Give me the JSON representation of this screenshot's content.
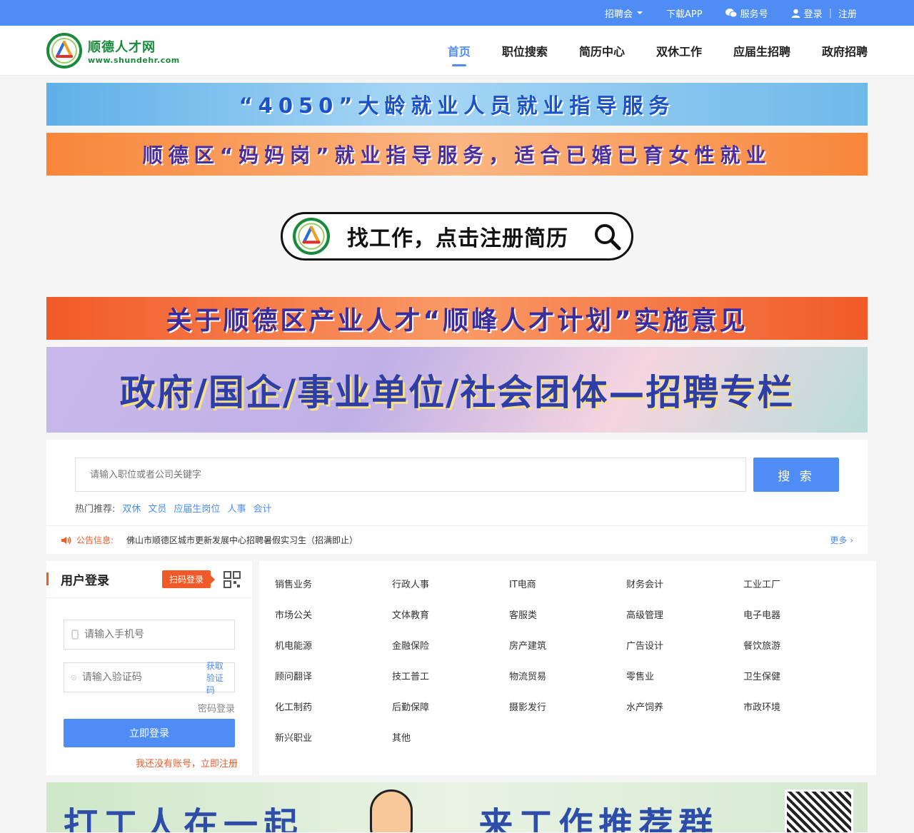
{
  "topbar": {
    "job_fair": "招聘会",
    "download_app": "下载APP",
    "service_account": "服务号",
    "login": "登录",
    "register": "注册"
  },
  "header": {
    "logo_name": "顺德人才网",
    "logo_url": "www.shundehr.com",
    "nav": [
      "首页",
      "职位搜索",
      "简历中心",
      "双休工作",
      "应届生招聘",
      "政府招聘"
    ],
    "active_nav": 0
  },
  "banners": {
    "b1": "“4050”大龄就业人员就业指导服务",
    "b2": "顺德区“妈妈岗”就业指导服务，适合已婚已育女性就业",
    "register_cta": "找工作，点击注册简历",
    "b3": "关于顺德区产业人才“顺峰人才计划”实施意见",
    "b4": "政府/国企/事业单位/社会团体—招聘专栏",
    "b5_left": "打工人在一起",
    "b5_right": "来工作推荐群"
  },
  "search": {
    "placeholder": "请输入职位或者公司关键字",
    "button": "搜 索",
    "hot_label": "热门推荐:",
    "hot_tags": [
      "双休",
      "文员",
      "应届生岗位",
      "人事",
      "会计"
    ]
  },
  "notice": {
    "label": "公告信息:",
    "text": "佛山市顺德区城市更新发展中心招聘暑假实习生（招满即止）",
    "more": "更多 ›"
  },
  "login": {
    "title": "用户登录",
    "scan_tag": "扫码登录",
    "phone_placeholder": "请输入手机号",
    "code_placeholder": "请输入验证码",
    "get_code": "获取验证码",
    "password_login": "密码登录",
    "submit": "立即登录",
    "register_link": "我还没有账号，立即注册"
  },
  "categories": [
    "销售业务",
    "行政人事",
    "IT电商",
    "财务会计",
    "工业工厂",
    "市场公关",
    "文体教育",
    "客服类",
    "高级管理",
    "电子电器",
    "机电能源",
    "金融保险",
    "房产建筑",
    "广告设计",
    "餐饮旅游",
    "顾问翻译",
    "技工普工",
    "物流贸易",
    "零售业",
    "卫生保健",
    "化工制药",
    "后勤保障",
    "摄影发行",
    "水产饲养",
    "市政环境",
    "新兴职业",
    "其他"
  ],
  "colors": {
    "primary": "#4f8df5",
    "accent": "#f05a28",
    "logo_green": "#1a8a3c"
  },
  "icons": {
    "dropdown": "chevron-down-icon",
    "wechat": "wechat-icon",
    "user": "user-icon",
    "search": "search-icon",
    "speaker": "speaker-icon",
    "qr": "qr-code-icon",
    "phone": "phone-icon",
    "shield": "shield-icon"
  }
}
